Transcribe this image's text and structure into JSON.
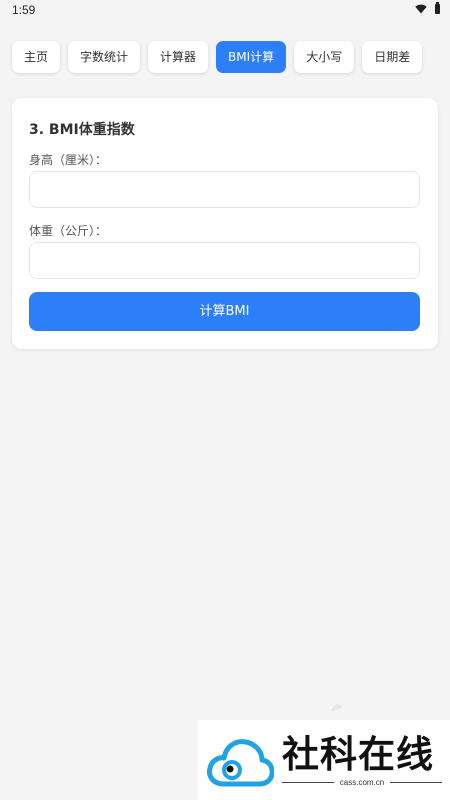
{
  "status_bar": {
    "time": "1:59"
  },
  "tabs": [
    {
      "label": "主页",
      "active": false
    },
    {
      "label": "字数统计",
      "active": false
    },
    {
      "label": "计算器",
      "active": false
    },
    {
      "label": "BMI计算",
      "active": true
    },
    {
      "label": "大小写",
      "active": false
    },
    {
      "label": "日期差",
      "active": false
    }
  ],
  "bmi_card": {
    "title": "3. BMI体重指数",
    "height_label": "身高（厘米）：",
    "height_value": "",
    "weight_label": "体重（公斤）：",
    "weight_value": "",
    "calculate_label": "计算BMI"
  },
  "watermark": {
    "brand": "社科在线",
    "domain": "cass.com.cn"
  },
  "colors": {
    "accent": "#2d7ff9",
    "background": "#f4f4f4",
    "card": "#ffffff",
    "logo_blue": "#1fa3e6"
  }
}
